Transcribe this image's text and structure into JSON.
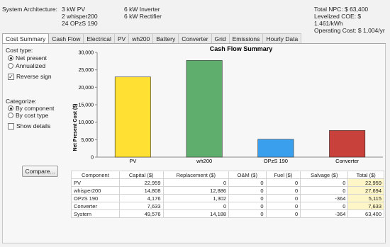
{
  "header": {
    "arch_label": "System Architecture:",
    "arch_col1": [
      "3 kW PV",
      "2 whisper200",
      "24 OPzS 190"
    ],
    "arch_col2": [
      "6 kW Inverter",
      "6 kW Rectifier"
    ],
    "summary": [
      "Total NPC: $ 63,400",
      "Levelized COE: $ 1.461/kWh",
      "Operating Cost: $ 1,004/yr"
    ]
  },
  "tabs": [
    "Cost Summary",
    "Cash Flow",
    "Electrical",
    "PV",
    "wh200",
    "Battery",
    "Converter",
    "Grid",
    "Emissions",
    "Hourly Data"
  ],
  "active_tab": "Cost Summary",
  "cost_type": {
    "label": "Cost type:",
    "options": [
      {
        "label": "Net present",
        "selected": true
      },
      {
        "label": "Annualized",
        "selected": false
      }
    ],
    "reverse_sign": {
      "label": "Reverse sign",
      "checked": true
    }
  },
  "categorize": {
    "label": "Categorize:",
    "options": [
      {
        "label": "By component",
        "selected": true
      },
      {
        "label": "By cost type",
        "selected": false
      }
    ],
    "show_details": {
      "label": "Show details",
      "checked": false
    }
  },
  "compare_button": "Compare...",
  "chart_data": {
    "type": "bar",
    "title": "Cash Flow Summary",
    "ylabel": "Net Present Cost ($)",
    "xlabel": "",
    "ylim": [
      0,
      30000
    ],
    "yticks": [
      "0",
      "5,000",
      "10,000",
      "15,000",
      "20,000",
      "25,000",
      "30,000"
    ],
    "categories": [
      "PV",
      "wh200",
      "OPzS 190",
      "Converter"
    ],
    "values": [
      22959,
      27694,
      5115,
      7633
    ],
    "colors": [
      "#ffe033",
      "#5fae6e",
      "#3aa0ee",
      "#c8413a"
    ],
    "grid": false
  },
  "table": {
    "columns": [
      "Component",
      "Capital ($)",
      "Replacement ($)",
      "O&M ($)",
      "Fuel ($)",
      "Salvage ($)",
      "Total ($)"
    ],
    "rows": [
      [
        "PV",
        "22,959",
        "0",
        "0",
        "0",
        "0",
        "22,959"
      ],
      [
        "whisper200",
        "14,808",
        "12,886",
        "0",
        "0",
        "0",
        "27,694"
      ],
      [
        "OPzS 190",
        "4,176",
        "1,302",
        "0",
        "0",
        "-364",
        "5,115"
      ],
      [
        "Converter",
        "7,633",
        "0",
        "0",
        "0",
        "0",
        "7,633"
      ],
      [
        "System",
        "49,576",
        "14,188",
        "0",
        "0",
        "-364",
        "63,400"
      ]
    ]
  }
}
